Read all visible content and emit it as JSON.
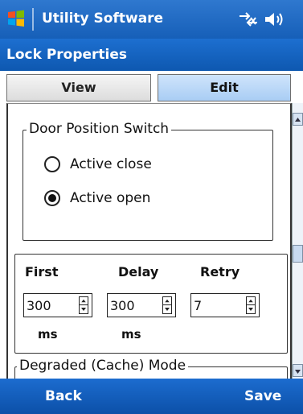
{
  "titlebar": {
    "app_title": "Utility Software",
    "logo_icon": "windows-logo-icon",
    "status_icons": [
      "connectivity-icon",
      "volume-icon"
    ]
  },
  "header": {
    "page_title": "Lock Properties"
  },
  "tabs": [
    {
      "label": "View",
      "selected": false
    },
    {
      "label": "Edit",
      "selected": true
    }
  ],
  "door_position": {
    "legend": "Door Position Switch",
    "options": [
      {
        "label": "Active close",
        "checked": false
      },
      {
        "label": "Active open",
        "checked": true
      }
    ]
  },
  "timing": {
    "columns": [
      {
        "label": "First",
        "value": "300",
        "unit": "ms"
      },
      {
        "label": "Delay",
        "value": "300",
        "unit": "ms"
      },
      {
        "label": "Retry",
        "value": "7",
        "unit": ""
      }
    ]
  },
  "degraded_mode": {
    "legend": "Degraded (Cache) Mode"
  },
  "softkeys": {
    "left": "Back",
    "right": "Save"
  },
  "colors": {
    "bar_blue": "#165fb8",
    "tab_selected": "#a9cdf4"
  }
}
